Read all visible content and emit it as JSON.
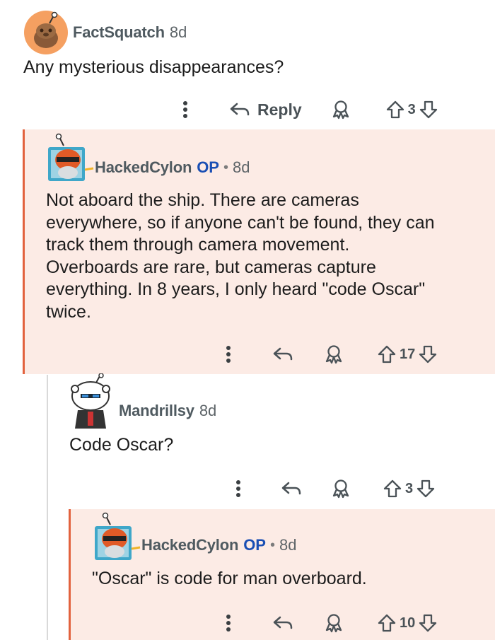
{
  "comments": [
    {
      "username": "FactSquatch",
      "op": "",
      "time": "8d",
      "body": "Any mysterious disappearances?",
      "reply_label": "Reply",
      "votes": "3"
    },
    {
      "username": "HackedCylon",
      "op": "OP",
      "time": "8d",
      "body": "Not aboard the ship. There are cameras\neverywhere, so if anyone can't be found, they can\ntrack them through camera movement.\nOverboards are rare, but cameras capture\neverything. In 8 years, I only heard \"code Oscar\"\ntwice.",
      "votes": "17"
    },
    {
      "username": "Mandrillsy",
      "op": "",
      "time": "8d",
      "body": "Code Oscar?",
      "votes": "3"
    },
    {
      "username": "HackedCylon",
      "op": "OP",
      "time": "8d",
      "body": "\"Oscar\" is code for man overboard.",
      "votes": "10"
    }
  ],
  "separator": "•",
  "icons": {
    "more": "more-vertical-icon",
    "reply": "reply-arrow-icon",
    "award": "award-icon",
    "upvote": "upvote-arrow-icon",
    "downvote": "downvote-arrow-icon"
  },
  "colors": {
    "highlight_bg": "#fcebe5",
    "thread_line": "#e2623e",
    "op_badge": "#1a4fb4"
  }
}
